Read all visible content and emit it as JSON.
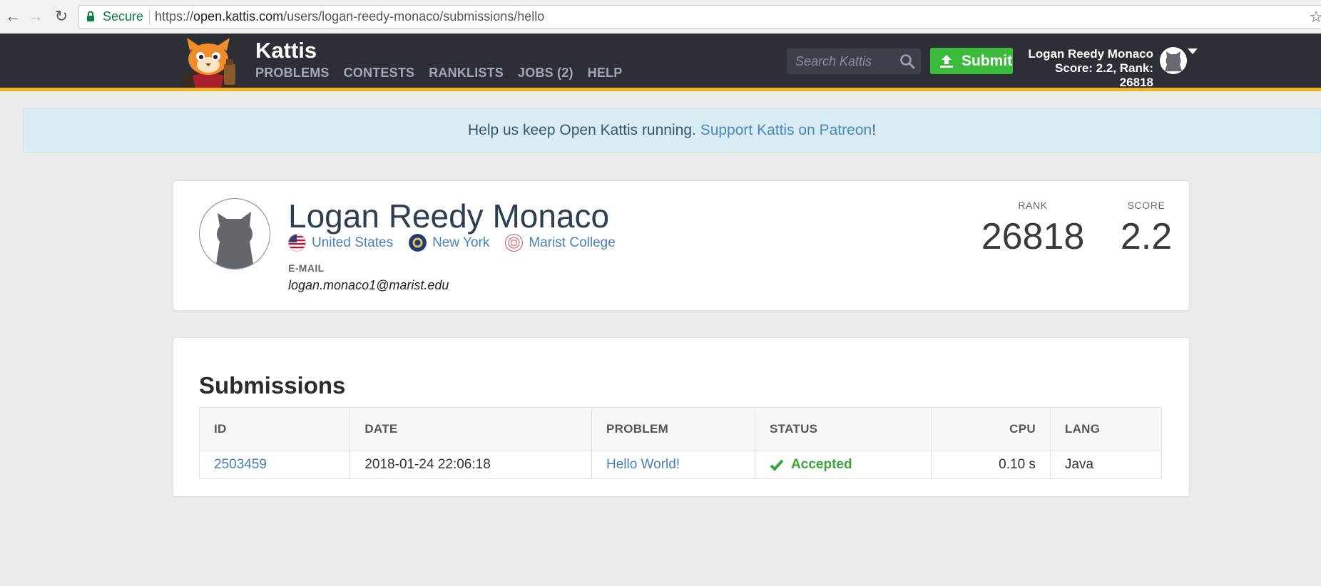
{
  "browser": {
    "secure_label": "Secure",
    "url_scheme": "https://",
    "url_host": "open.kattis.com",
    "url_path": "/users/logan-reedy-monaco/submissions/hello"
  },
  "header": {
    "brand": "Kattis",
    "menu": [
      "PROBLEMS",
      "CONTESTS",
      "RANKLISTS",
      "JOBS (2)",
      "HELP"
    ],
    "search_placeholder": "Search Kattis",
    "submit_label": "Submit",
    "user_name": "Logan Reedy Monaco",
    "user_stats": "Score: 2.2, Rank: 26818",
    "accent_color": "#f0b323",
    "submit_color": "#3cba3c"
  },
  "banner": {
    "text": "Help us keep Open Kattis running.",
    "link": "Support Kattis on Patreon",
    "suffix": "!"
  },
  "profile": {
    "name": "Logan Reedy Monaco",
    "country": "United States",
    "state": "New York",
    "school": "Marist College",
    "email_label": "E-MAIL",
    "email": "logan.monaco1@marist.edu",
    "rank_label": "RANK",
    "rank": "26818",
    "score_label": "SCORE",
    "score": "2.2"
  },
  "submissions": {
    "title": "Submissions",
    "columns": [
      "ID",
      "DATE",
      "PROBLEM",
      "STATUS",
      "CPU",
      "LANG"
    ],
    "rows": [
      {
        "id": "2503459",
        "date": "2018-01-24 22:06:18",
        "problem": "Hello World!",
        "status": "Accepted",
        "cpu": "0.10 s",
        "lang": "Java"
      }
    ]
  }
}
